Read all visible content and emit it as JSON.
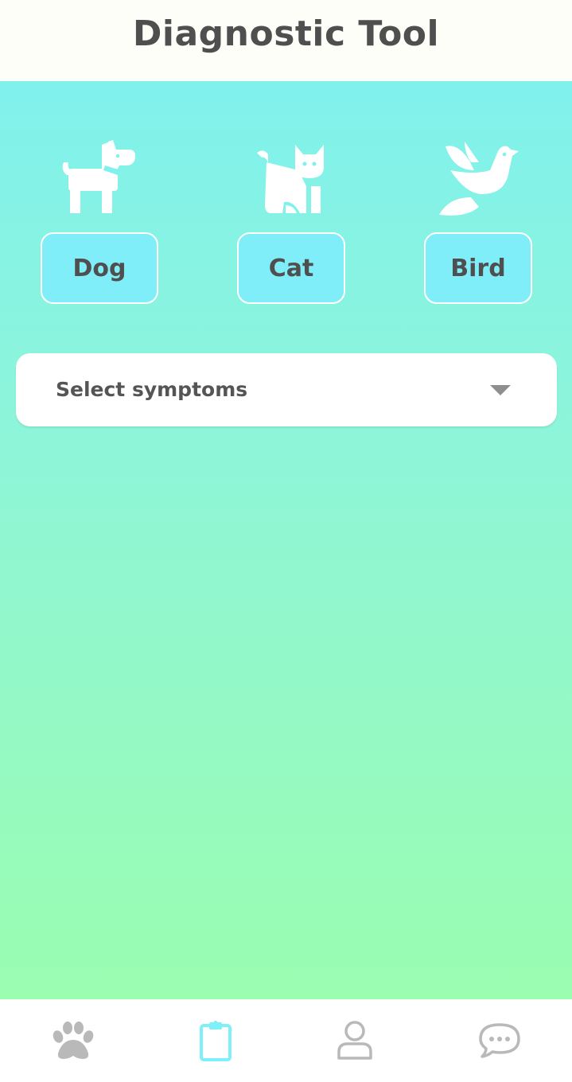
{
  "header": {
    "title": "Diagnostic Tool"
  },
  "animals": [
    {
      "label": "Dog",
      "icon": "dog-icon"
    },
    {
      "label": "Cat",
      "icon": "cat-icon"
    },
    {
      "label": "Bird",
      "icon": "bird-icon"
    }
  ],
  "symptoms": {
    "placeholder": "Select symptoms"
  },
  "tabbar": {
    "items": [
      {
        "icon": "paw-icon",
        "active": false
      },
      {
        "icon": "clipboard-icon",
        "active": true
      },
      {
        "icon": "user-icon",
        "active": false
      },
      {
        "icon": "chat-icon",
        "active": false
      }
    ]
  },
  "colors": {
    "header_bg": "#fdfef8",
    "title_text": "#4f4f4f",
    "gradient_top": "#80f1ec",
    "gradient_bottom": "#9afdb0",
    "animal_button_bg": "#80eef9",
    "tab_inactive": "#b9b9b9",
    "tab_active": "#7ef0f8"
  }
}
